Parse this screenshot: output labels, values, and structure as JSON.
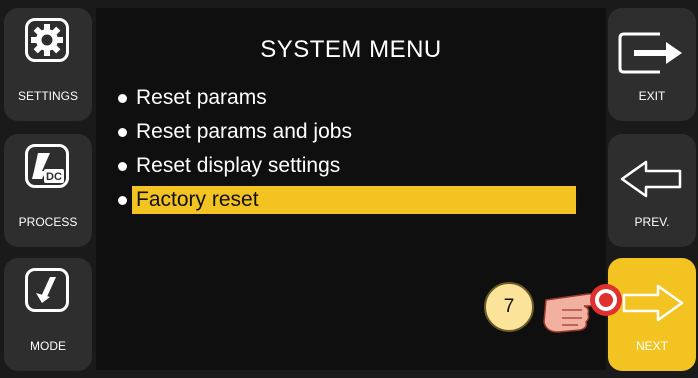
{
  "colors": {
    "accent": "#f3c321",
    "screen": "#0f0f0f",
    "button": "#2e2e2e"
  },
  "title": "SYSTEM MENU",
  "menu": [
    {
      "label": "Reset params",
      "selected": false
    },
    {
      "label": "Reset params and jobs",
      "selected": false
    },
    {
      "label": "Reset display settings",
      "selected": false
    },
    {
      "label": "Factory reset",
      "selected": true
    }
  ],
  "left_buttons": {
    "settings": {
      "label": "SETTINGS",
      "icon": "gear-icon"
    },
    "process": {
      "label": "PROCESS",
      "icon": "welding-torch-icon",
      "icon_text": "DC"
    },
    "mode": {
      "label": "MODE",
      "icon": "trigger-mode-icon"
    }
  },
  "right_buttons": {
    "exit": {
      "label": "EXIT",
      "icon": "exit-icon"
    },
    "prev": {
      "label": "PREV.",
      "icon": "arrow-left-icon"
    },
    "next": {
      "label": "NEXT",
      "icon": "arrow-right-icon"
    }
  },
  "step_badge": "7"
}
